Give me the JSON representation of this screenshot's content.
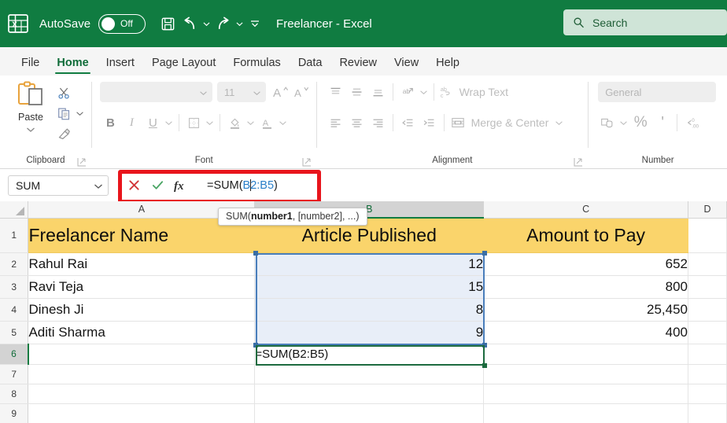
{
  "titlebar": {
    "app_icon": "excel-logo-icon",
    "autosave_label": "AutoSave",
    "autosave_state": "Off",
    "save_icon": "save-icon",
    "undo_icon": "undo-icon",
    "redo_icon": "redo-icon",
    "qat_customize_icon": "chevron-down-icon",
    "document_title": "Freelancer  -  Excel",
    "brand_green": "#107c41"
  },
  "search": {
    "icon": "search-icon",
    "placeholder": "Search",
    "value": "Search"
  },
  "tabs": [
    {
      "label": "File",
      "active": false
    },
    {
      "label": "Home",
      "active": true
    },
    {
      "label": "Insert",
      "active": false
    },
    {
      "label": "Page Layout",
      "active": false
    },
    {
      "label": "Formulas",
      "active": false
    },
    {
      "label": "Data",
      "active": false
    },
    {
      "label": "Review",
      "active": false
    },
    {
      "label": "View",
      "active": false
    },
    {
      "label": "Help",
      "active": false
    }
  ],
  "ribbon": {
    "clipboard": {
      "group_label": "Clipboard",
      "paste_label": "Paste",
      "paste_icon": "paste-clipboard-icon",
      "cut_icon": "scissors-icon",
      "copy_icon": "copy-icon",
      "format_painter_icon": "format-painter-icon",
      "dialog_launcher_icon": "dialog-launcher-icon"
    },
    "font": {
      "group_label": "Font",
      "font_name_value": "",
      "font_size_value": "11",
      "grow_font_icon": "grow-font-icon",
      "shrink_font_icon": "shrink-font-icon",
      "bold_label": "B",
      "italic_label": "I",
      "underline_label": "U",
      "borders_icon": "borders-icon",
      "fill_color_icon": "fill-color-icon",
      "font_color_icon": "font-color-icon",
      "dialog_launcher_icon": "dialog-launcher-icon"
    },
    "alignment": {
      "group_label": "Alignment",
      "align_top_icon": "align-top-icon",
      "align_middle_icon": "align-middle-icon",
      "align_bottom_icon": "align-bottom-icon",
      "orientation_icon": "text-orientation-icon",
      "wrap_text_label": "Wrap Text",
      "wrap_text_icon": "wrap-text-icon",
      "align_left_icon": "align-left-icon",
      "align_center_icon": "align-center-icon",
      "align_right_icon": "align-right-icon",
      "decrease_indent_icon": "decrease-indent-icon",
      "increase_indent_icon": "increase-indent-icon",
      "merge_center_label": "Merge & Center",
      "merge_center_icon": "merge-cells-icon",
      "dialog_launcher_icon": "dialog-launcher-icon"
    },
    "number": {
      "group_label": "Number",
      "format_value": "General",
      "accounting_icon": "accounting-format-icon",
      "percent_label": "%",
      "comma_label": "'",
      "decrease_decimal_icon": "decrease-decimal-icon"
    }
  },
  "formula_bar": {
    "name_box_value": "SUM",
    "name_box_caret_icon": "chevron-down-icon",
    "cancel_icon": "cancel-x-icon",
    "enter_icon": "enter-check-icon",
    "insert_function_icon": "fx-icon",
    "formula_prefix": "=SUM(",
    "formula_arg_head": "B",
    "formula_arg_tail": "2:B5",
    "formula_suffix": ")",
    "full_formula": "=SUM(B2:B5)",
    "highlight_color": "#e8151c"
  },
  "tooltip": {
    "prefix": "SUM(",
    "bold_part": "number1",
    "suffix": ", [number2], ...)"
  },
  "sheet": {
    "columns": [
      {
        "label": "A",
        "selected": false
      },
      {
        "label": "B",
        "selected": true
      },
      {
        "label": "C",
        "selected": false
      },
      {
        "label": "D",
        "selected": false
      }
    ],
    "rows": [
      {
        "num": "1",
        "selected": false,
        "header": true,
        "cells": [
          "Freelancer Name",
          "Article Published",
          "Amount to Pay",
          ""
        ]
      },
      {
        "num": "2",
        "selected": false,
        "header": false,
        "cells": [
          "Rahul Rai",
          "12",
          "652",
          ""
        ]
      },
      {
        "num": "3",
        "selected": false,
        "header": false,
        "cells": [
          "Ravi Teja",
          "15",
          "800",
          ""
        ]
      },
      {
        "num": "4",
        "selected": false,
        "header": false,
        "cells": [
          "Dinesh Ji",
          "8",
          "25,450",
          ""
        ]
      },
      {
        "num": "5",
        "selected": false,
        "header": false,
        "cells": [
          "Aditi Sharma",
          "9",
          "400",
          ""
        ]
      },
      {
        "num": "6",
        "selected": true,
        "header": false,
        "cells": [
          "",
          "=SUM(B2:B5)",
          "",
          ""
        ]
      },
      {
        "num": "7",
        "selected": false,
        "header": false,
        "cells": [
          "",
          "",
          "",
          ""
        ]
      },
      {
        "num": "8",
        "selected": false,
        "header": false,
        "cells": [
          "",
          "",
          "",
          ""
        ]
      },
      {
        "num": "9",
        "selected": false,
        "header": false,
        "cells": [
          "",
          "",
          "",
          ""
        ]
      }
    ],
    "selected_range": "B2:B5",
    "active_cell": "B6",
    "header_fill_color": "#fad46b",
    "range_border_color": "#4a7ebb",
    "active_border_color": "#1d6b3f"
  }
}
